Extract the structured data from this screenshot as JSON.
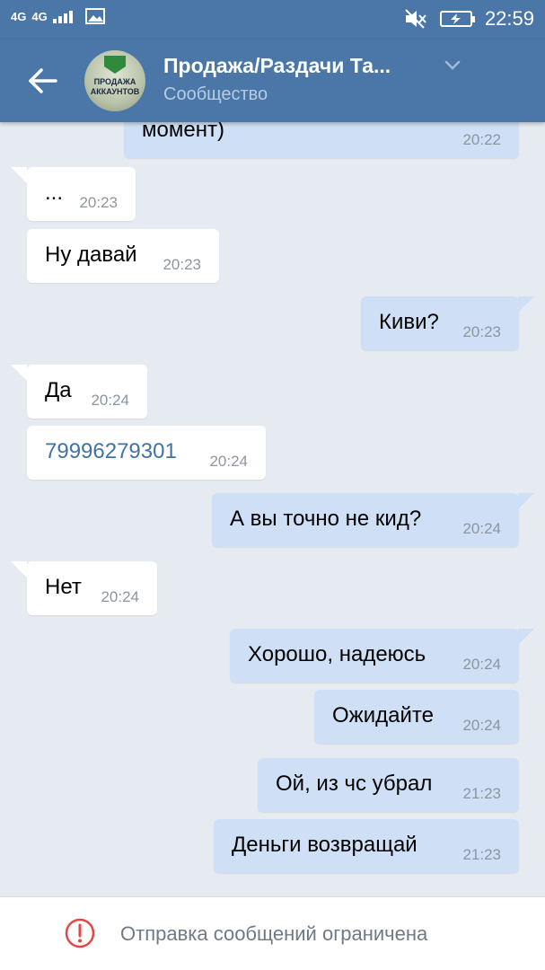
{
  "status_bar": {
    "network": "4G",
    "network2": "4G",
    "time": "22:59"
  },
  "header": {
    "title": "Продажа/Раздачи Та...",
    "subtitle": "Сообщество",
    "avatar_text_line1": "ПРОДАЖА",
    "avatar_text_line2": "АККАУНТОВ"
  },
  "messages": [
    {
      "dir": "out",
      "text": "момент)",
      "time": "20:22"
    },
    {
      "dir": "in",
      "text": "...",
      "time": "20:23"
    },
    {
      "dir": "in",
      "text": "Ну давай",
      "time": "20:23"
    },
    {
      "dir": "out",
      "text": "Киви?",
      "time": "20:23"
    },
    {
      "dir": "in",
      "text": "Да",
      "time": "20:24"
    },
    {
      "dir": "in",
      "text": "79996279301",
      "time": "20:24",
      "link": true
    },
    {
      "dir": "out",
      "text": "А вы точно не кид?",
      "time": "20:24"
    },
    {
      "dir": "in",
      "text": "Нет",
      "time": "20:24"
    },
    {
      "dir": "out",
      "text": "Хорошо, надеюсь",
      "time": "20:24"
    },
    {
      "dir": "out",
      "text": "Ожидайте",
      "time": "20:24"
    },
    {
      "dir": "out",
      "text": "Ой, из чс убрал",
      "time": "21:23"
    },
    {
      "dir": "out",
      "text": "Деньги возвращай",
      "time": "21:23"
    }
  ],
  "footer": {
    "restriction_text": "Отправка сообщений ограничена"
  },
  "colors": {
    "header_bg": "#4a76a8",
    "chat_bg": "#e6ebf2",
    "incoming_bubble": "#ffffff",
    "outgoing_bubble": "#cfe0f6",
    "warning_red": "#e64646",
    "link": "#3f73a6"
  },
  "icons": {
    "back": "arrow-left-icon",
    "dropdown": "chevron-down-icon",
    "warning": "exclamation-circle-icon",
    "mute": "mute-icon",
    "battery": "battery-charging-icon",
    "image": "image-icon"
  }
}
